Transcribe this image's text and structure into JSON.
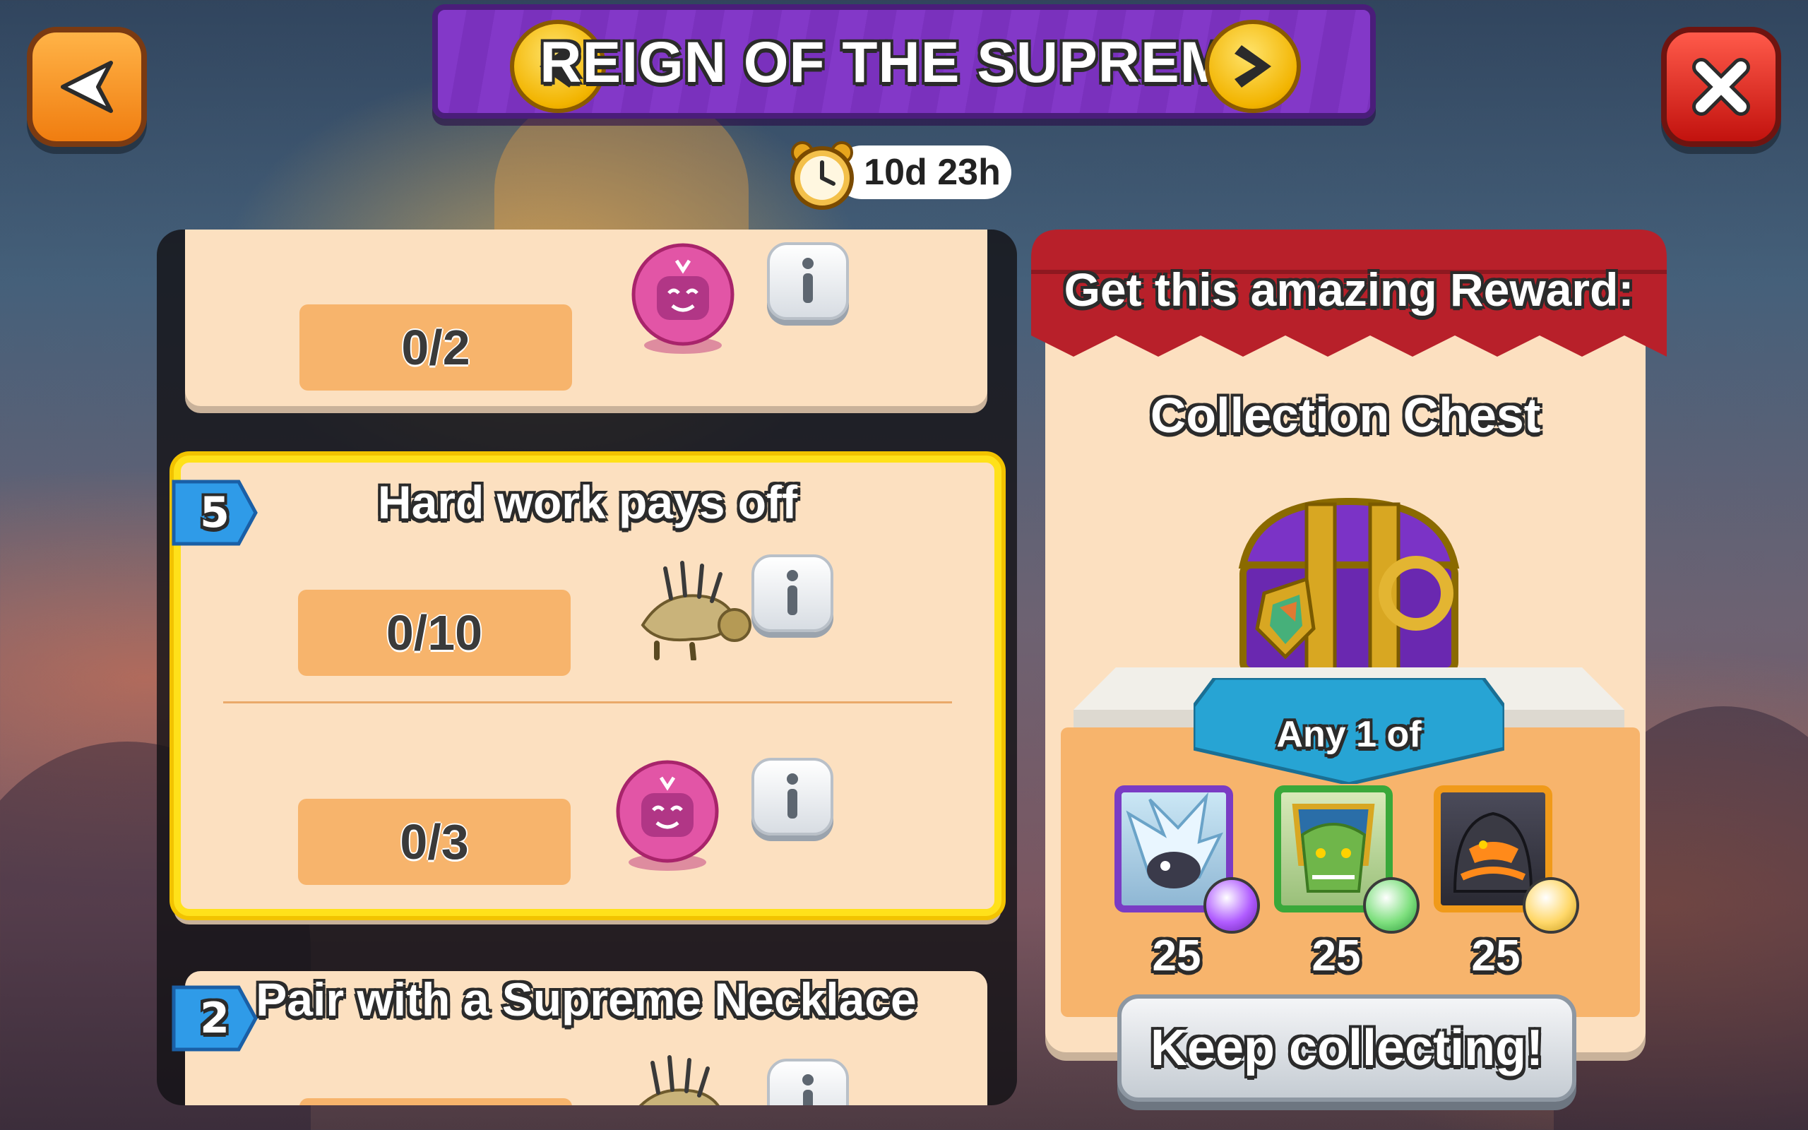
{
  "header": {
    "title": "REIGN OF THE SUPREME",
    "timer": "10d 23h"
  },
  "tasks": {
    "top_card": {
      "progress": "0/2",
      "item_icon": "pink-orb-icon"
    },
    "highlight_card": {
      "badge": "5",
      "title": "Hard work pays off",
      "rows": [
        {
          "progress": "0/10",
          "item_icon": "spiky-dragon-icon"
        },
        {
          "progress": "0/3",
          "item_icon": "pink-orb-icon"
        }
      ]
    },
    "bottom_card": {
      "badge": "2",
      "title": "Pair with a Supreme Necklace"
    }
  },
  "reward": {
    "header": "Get this amazing Reward:",
    "chest_name": "Collection Chest",
    "choice_label": "Any 1 of",
    "items": [
      {
        "count": "25",
        "frame_color": "#7a3cc4",
        "potion_color": "#b05cff"
      },
      {
        "count": "25",
        "frame_color": "#3aa83a",
        "potion_color": "#7fe07f"
      },
      {
        "count": "25",
        "frame_color": "#f09a1a",
        "potion_color": "#ffd86a"
      }
    ],
    "button_label": "Keep collecting!"
  }
}
